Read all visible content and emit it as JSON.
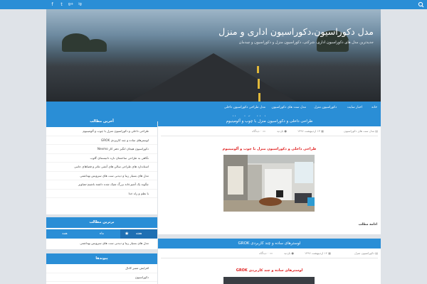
{
  "topbar": {
    "social": [
      "f",
      "t",
      "g+",
      "ig"
    ]
  },
  "header": {
    "title": "مدل دکوراسیون،دکوراسیون اداری و منزل",
    "subtitle": "جدیدترین مدل های دکوراسیون اداری، شرکتی، دکوراسیون منزل و دکوراسیون و چیدمان"
  },
  "nav": {
    "items": [
      "خانه",
      "اخبار سایت",
      "دکوراسیون منزل",
      "مدل ست های دکوراسیون",
      "مدل طراحی دکوراسیون داخلی"
    ],
    "row2": [
      "مدل طراحی دکوراسیون اداری"
    ]
  },
  "posts": [
    {
      "title": "طراحی داخلی و دکوراسیون منزل با چوب و آلومینیوم",
      "category": "مدل ست های دکوراسیون",
      "date": "۱۳ اردیبهشت ۱۳۹۶",
      "author": "بازدید",
      "comments": "۰ دیدگاه",
      "inner_title": "طراحی داخلی و دکوراسیون منزل با چوب و آلومینیوم",
      "more": "ادامه مطلب"
    },
    {
      "title": "لوسترهای ساده و چند کاربردی GROK",
      "category": "دکوراسیون منزل",
      "date": "۱۲ اردیبهشت ۱۳۹۶",
      "author": "بازدید",
      "comments": "۰ دیدگاه",
      "inner_title": "لوسترهای ساده و چند کاربردی GROK"
    }
  ],
  "sidebar": {
    "latest_title": "آخرین مطالب",
    "latest": [
      "طراحی داخلی و دکوراسیون منزل با چوب و آلومینیوم",
      "لوسترهای ساده و چند کاربردی GROK",
      "دکوراسیون هیجان انگیز دفتر کار Nexmo",
      "نگاهی به طراحی ساختمان نازه دانیستنای گلوب",
      "استاندارد های طراحی سالن های آمفی تئاتر و فضاهای جانبی",
      "مدل های بسیار زیبا و دیدنی ست های سرویس بهداشتی",
      "چگونه یک آشپزخانه بزرگ شیک شده داشته باشیم-تصاویر",
      "با نظم و راه خدا"
    ],
    "top_title": "برترین مطالب",
    "tabs": [
      "هفته",
      "ماه",
      "همه"
    ],
    "top_items": [
      "مدل های بسیار زیبا و دیدنی ست های سرویس بهداشتی"
    ],
    "links_title": "پیوندها",
    "links": [
      "افزایش ممبر کانال",
      "دکوراسیون"
    ]
  },
  "colors": {
    "accent": "#2a8ed6",
    "red_title": "#e02020",
    "page_bg": "#dfe3e8"
  }
}
